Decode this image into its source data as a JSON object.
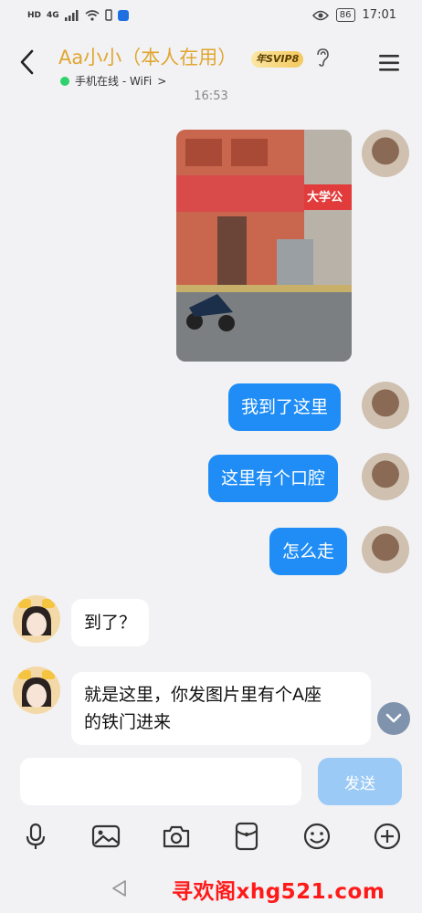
{
  "status_bar": {
    "left_icons": [
      "HD",
      "4G"
    ],
    "battery": "86",
    "time": "17:01"
  },
  "header": {
    "contact_name": "Aa小小（本人在用）",
    "vip_badge": "年SVIP8",
    "online_status": "手机在线 - WiFi",
    "online_chevron": ">"
  },
  "chat": {
    "timestamp": "16:53",
    "messages": [
      {
        "from": "me",
        "type": "image"
      },
      {
        "from": "me",
        "text": "我到了这里"
      },
      {
        "from": "me",
        "text": "这里有个口腔"
      },
      {
        "from": "me",
        "text": "怎么走"
      },
      {
        "from": "other",
        "text": "到了？"
      },
      {
        "from": "other",
        "text_line1": "就是这里，你发图片里有个A座",
        "text_line2": "的铁门进来"
      }
    ],
    "photo_sign": "大学公"
  },
  "composer": {
    "input_value": "",
    "send_label": "发送"
  },
  "toolbar": {
    "icons": [
      "microphone-icon",
      "image-icon",
      "camera-icon",
      "red-packet-icon",
      "emoji-icon",
      "plus-icon"
    ]
  },
  "watermark": "寻欢阁xhg521.com",
  "colors": {
    "accent": "#1f8df5",
    "title": "#e0a631",
    "send_disabled": "#9ccaf6",
    "watermark": "#ff1a1a"
  }
}
